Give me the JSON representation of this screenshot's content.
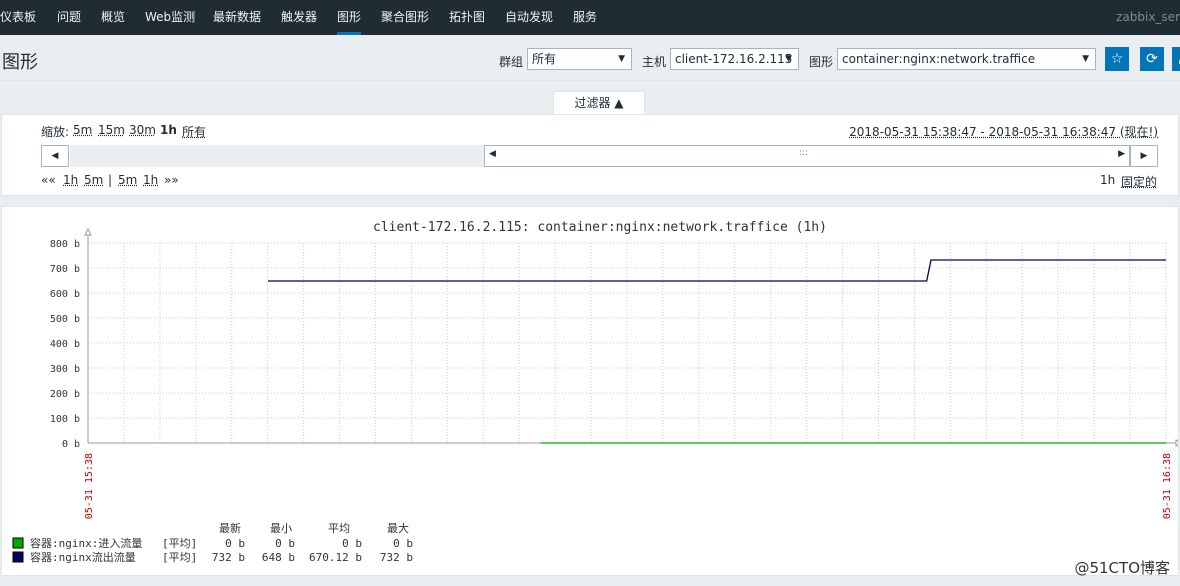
{
  "nav": {
    "items": [
      "仪表板",
      "问题",
      "概览",
      "Web监测",
      "最新数据",
      "触发器",
      "图形",
      "聚合图形",
      "拓扑图",
      "自动发现",
      "服务"
    ],
    "active_index": 6,
    "brand": "zabbix_ser"
  },
  "header": {
    "title": "图形",
    "group_label": "群组",
    "group_value": "所有",
    "host_label": "主机",
    "host_value": "client-172.16.2.115",
    "graph_label": "图形",
    "graph_value": "container:nginx:network.traffice",
    "favorite_icon": "star-icon",
    "refresh_icon": "refresh-icon",
    "fullscreen_icon": "fullscreen-icon"
  },
  "filter": {
    "tab_label": "过滤器 ▲",
    "zoom_label": "缩放:",
    "zoom_options": [
      "5m",
      "15m",
      "30m",
      "1h",
      "所有"
    ],
    "zoom_active": "1h",
    "range_text": "2018-05-31 15:38:47 - 2018-05-31 16:38:47 (现在!)",
    "nav_left": "««",
    "nav_back": [
      "1h",
      "5m"
    ],
    "nav_sep": "|",
    "nav_fwd": [
      "5m",
      "1h"
    ],
    "nav_right": "»»",
    "period": "1h",
    "fixed_label": "固定的",
    "handle": ":::"
  },
  "chart_data": {
    "type": "line",
    "title": "client-172.16.2.115: container:nginx:network.traffice (1h)",
    "ylim": [
      0,
      800
    ],
    "y_ticks": [
      0,
      100,
      200,
      300,
      400,
      500,
      600,
      700,
      800
    ],
    "y_unit": "b",
    "x_start_label": "05-31 15:38",
    "x_end_label": "05-31 16:38",
    "grid": true,
    "series": [
      {
        "name": "容器:nginx:进入流量",
        "color": "#00aa00",
        "func": "[平均]",
        "last": "0 b",
        "min": "0 b",
        "avg": "0 b",
        "max": "0 b",
        "points": [
          [
            0.42,
            0
          ],
          [
            1.0,
            0
          ]
        ]
      },
      {
        "name": "容器:nginx流出流量",
        "color": "#000066",
        "func": "[平均]",
        "last": "732 b",
        "min": "648 b",
        "avg": "670.12 b",
        "max": "732 b",
        "points": [
          [
            0.167,
            648
          ],
          [
            0.778,
            648
          ],
          [
            0.782,
            732
          ],
          [
            1.0,
            732
          ]
        ]
      }
    ],
    "legend_headers": [
      "最新",
      "最小",
      "平均",
      "最大"
    ]
  },
  "watermark": "@51CTO博客"
}
